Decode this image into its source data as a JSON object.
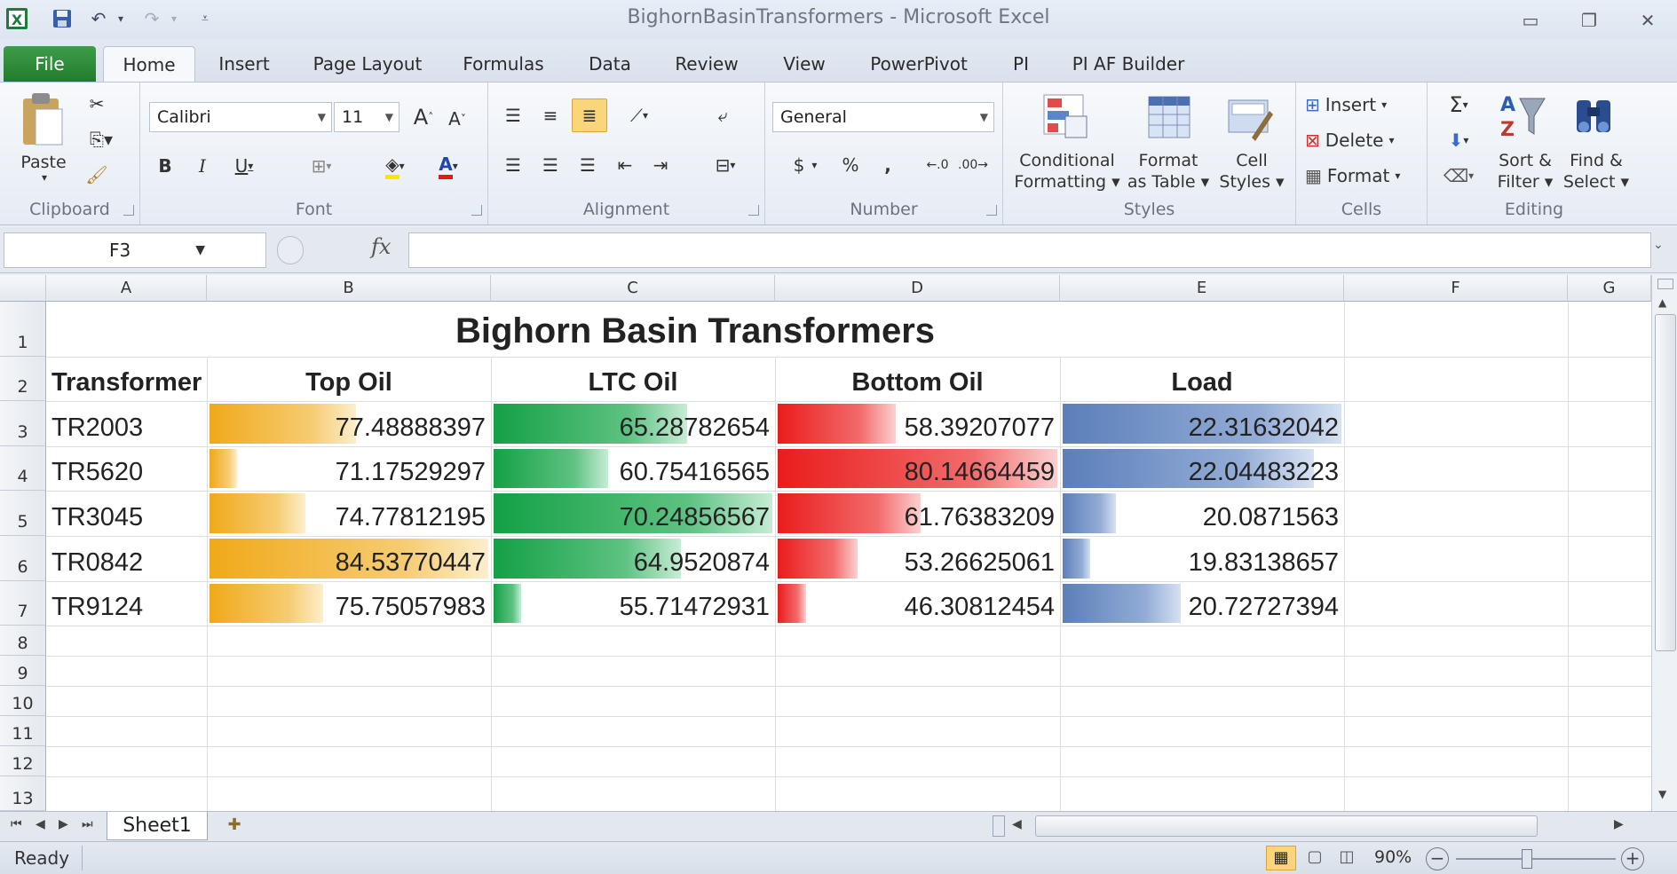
{
  "app": {
    "title": "BighornBasinTransformers  -  Microsoft Excel",
    "accent": "#217346"
  },
  "tabs": [
    {
      "label": "File"
    },
    {
      "label": "Home"
    },
    {
      "label": "Insert"
    },
    {
      "label": "Page Layout"
    },
    {
      "label": "Formulas"
    },
    {
      "label": "Data"
    },
    {
      "label": "Review"
    },
    {
      "label": "View"
    },
    {
      "label": "PowerPivot"
    },
    {
      "label": "PI"
    },
    {
      "label": "PI AF Builder"
    }
  ],
  "ribbon": {
    "clipboard": {
      "label": "Clipboard",
      "paste": "Paste"
    },
    "font": {
      "label": "Font",
      "name": "Calibri",
      "size": "11"
    },
    "alignment": {
      "label": "Alignment"
    },
    "number": {
      "label": "Number",
      "format": "General"
    },
    "styles": {
      "label": "Styles",
      "cond1": "Conditional",
      "cond2": "Formatting",
      "fmt1": "Format",
      "fmt2": "as Table",
      "cell1": "Cell",
      "cell2": "Styles"
    },
    "cells": {
      "label": "Cells",
      "insert": "Insert",
      "delete": "Delete",
      "format": "Format"
    },
    "editing": {
      "label": "Editing",
      "sort1": "Sort &",
      "sort2": "Filter",
      "find1": "Find &",
      "find2": "Select"
    }
  },
  "formula_bar": {
    "name_box": "F3",
    "fx": "fx",
    "formula": ""
  },
  "columns": [
    "A",
    "B",
    "C",
    "D",
    "E",
    "F",
    "G"
  ],
  "rows": [
    "1",
    "2",
    "3",
    "4",
    "5",
    "6",
    "7",
    "8",
    "9",
    "10",
    "11",
    "12",
    "13"
  ],
  "sheet": {
    "title": "Bighorn Basin Transformers",
    "headers": [
      "Transformer",
      "Top Oil",
      "LTC Oil",
      "Bottom Oil",
      "Load"
    ],
    "records": [
      {
        "name": "TR2003",
        "top_oil": "77.48888397",
        "ltc_oil": "65.28782654",
        "bottom_oil": "58.39207077",
        "load": "22.31632042"
      },
      {
        "name": "TR5620",
        "top_oil": "71.17529297",
        "ltc_oil": "60.75416565",
        "bottom_oil": "80.14664459",
        "load": "22.04483223"
      },
      {
        "name": "TR3045",
        "top_oil": "74.77812195",
        "ltc_oil": "70.24856567",
        "bottom_oil": "61.76383209",
        "load": "20.0871563"
      },
      {
        "name": "TR0842",
        "top_oil": "84.53770447",
        "ltc_oil": "64.9520874",
        "bottom_oil": "53.26625061",
        "load": "19.83138657"
      },
      {
        "name": "TR9124",
        "top_oil": "75.75057983",
        "ltc_oil": "55.71472931",
        "bottom_oil": "46.30812454",
        "load": "20.72727394"
      }
    ],
    "databar_colors": {
      "top_oil": "#f0a91a",
      "ltc_oil": "#14a045",
      "bottom_oil": "#ea1c1c",
      "load": "#5b7fba"
    }
  },
  "sheet_tabs": [
    {
      "label": "Sheet1"
    }
  ],
  "status": {
    "text": "Ready",
    "zoom": "90%"
  }
}
